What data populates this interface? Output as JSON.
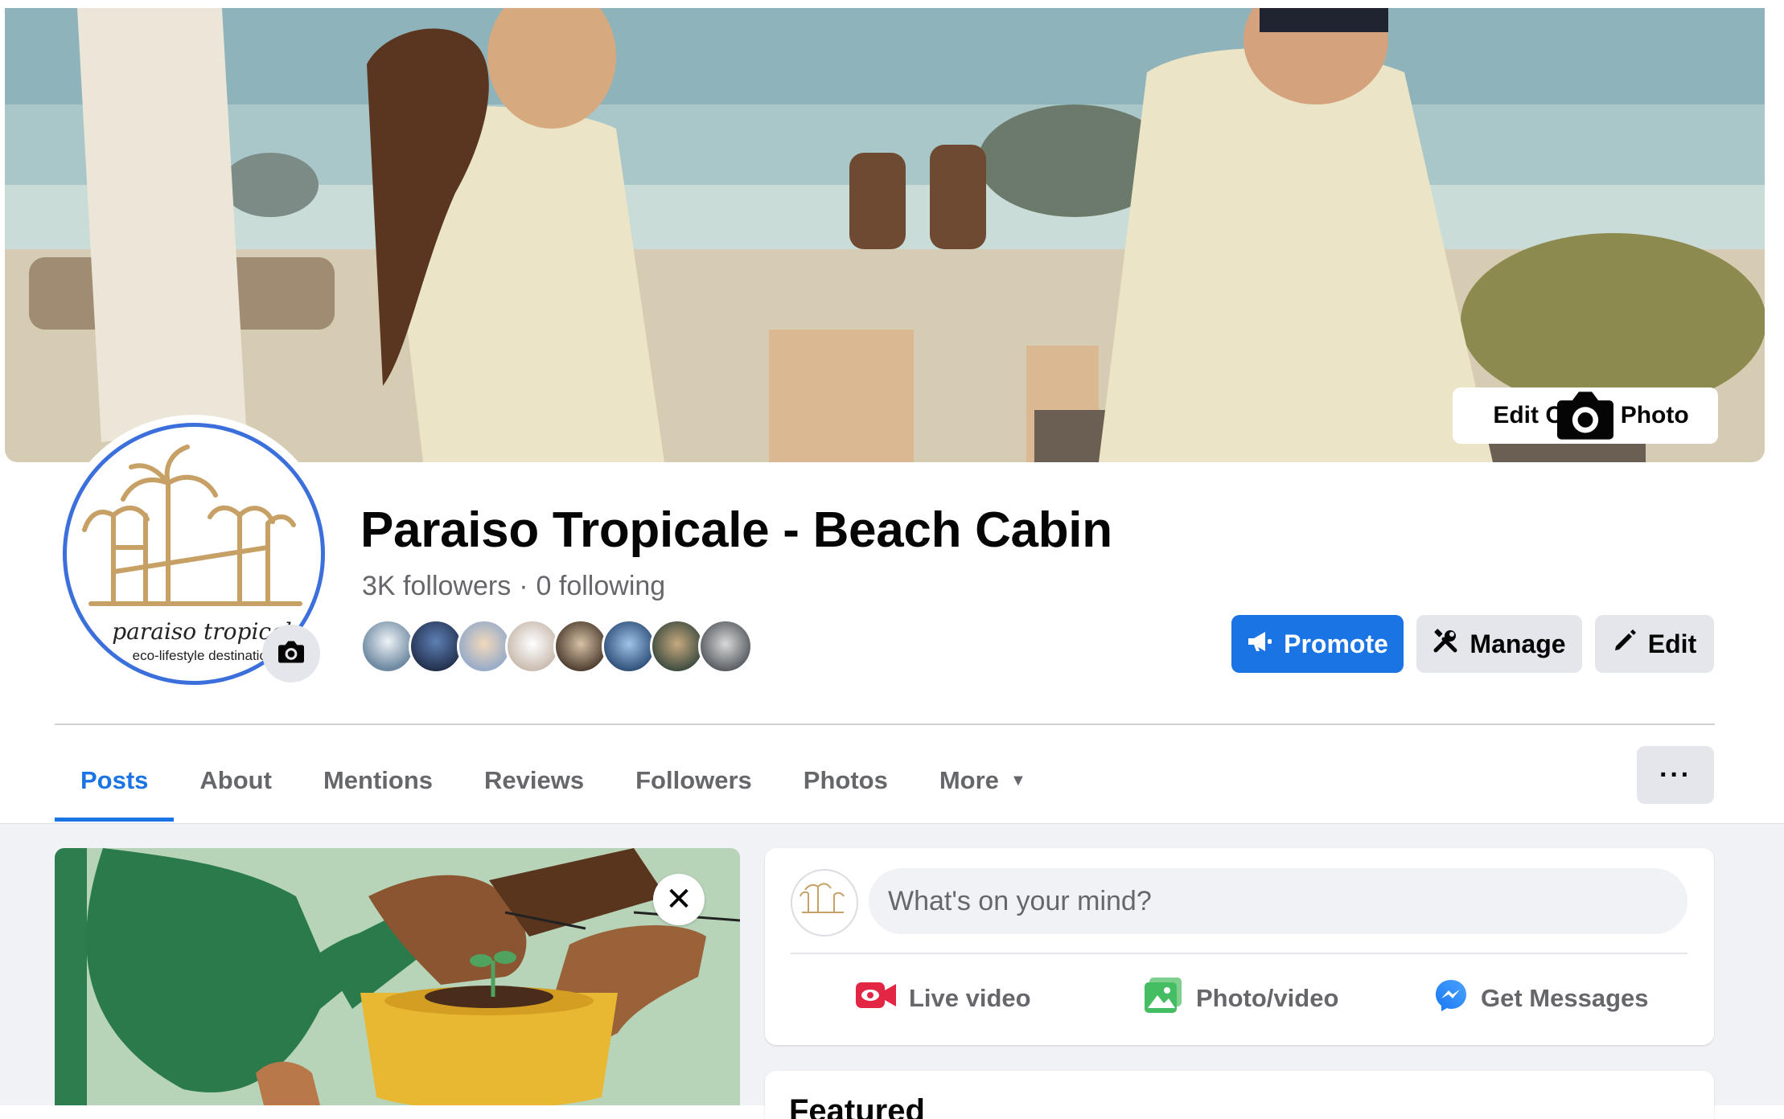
{
  "cover": {
    "edit_cover_label": "Edit Cover Photo"
  },
  "profile": {
    "logo_text": "paraiso tropical",
    "logo_subtext": "eco-lifestyle destination",
    "name": "Paraiso Tropicale - Beach Cabin",
    "followers": "3K followers",
    "separator": "·",
    "following": "0 following"
  },
  "actions": {
    "promote": "Promote",
    "manage": "Manage",
    "edit": "Edit"
  },
  "tabs": [
    {
      "label": "Posts",
      "active": true
    },
    {
      "label": "About"
    },
    {
      "label": "Mentions"
    },
    {
      "label": "Reviews"
    },
    {
      "label": "Followers"
    },
    {
      "label": "Photos"
    },
    {
      "label": "More"
    }
  ],
  "more_options": "···",
  "promo": {
    "close": "✕"
  },
  "composer": {
    "placeholder": "What's on your mind?",
    "live_video": "Live video",
    "photo_video": "Photo/video",
    "get_messages": "Get Messages"
  },
  "featured": {
    "title": "Featured"
  },
  "colors": {
    "accent": "#1b74e4",
    "avatar_ring": "#3b6fdc",
    "live_red": "#e42645",
    "photo_green": "#45bd62"
  }
}
